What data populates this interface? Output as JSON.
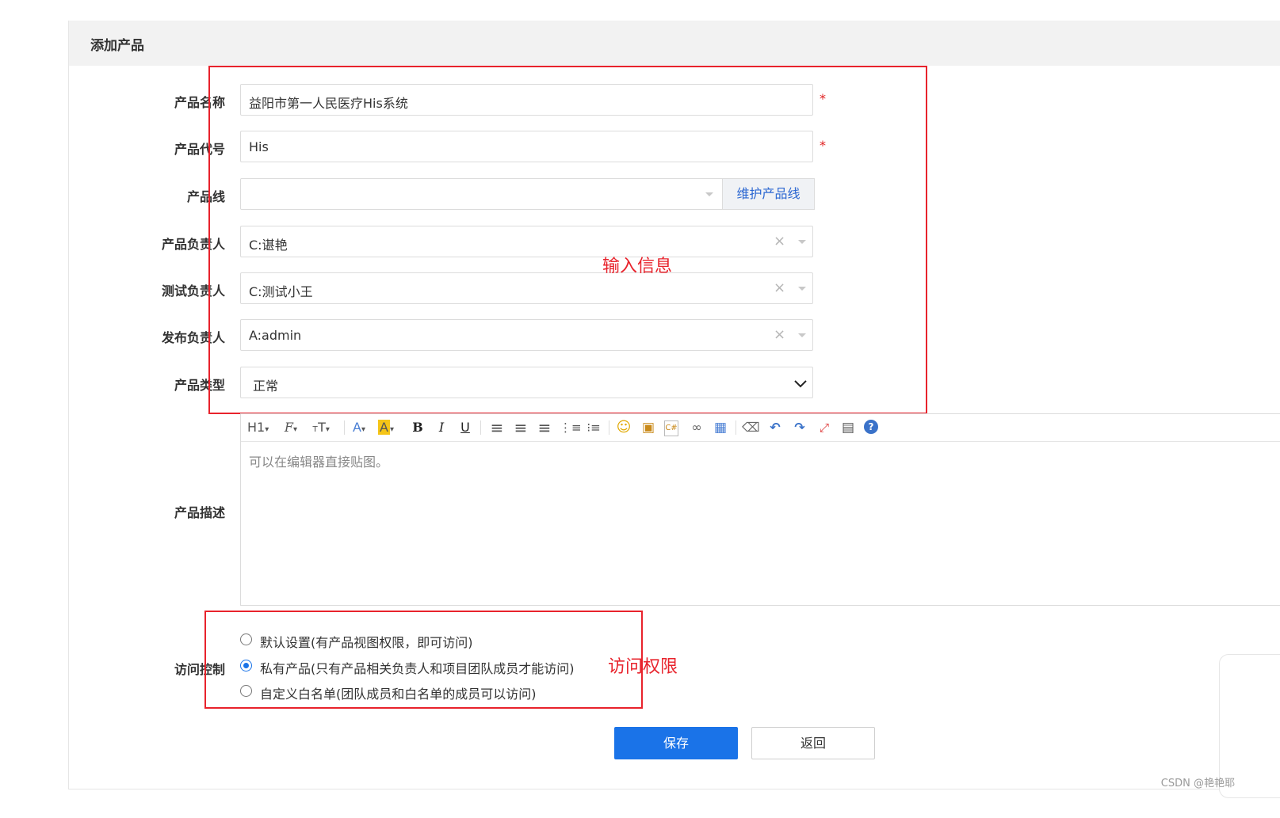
{
  "page": {
    "title": "添加产品"
  },
  "form": {
    "product_name": {
      "label": "产品名称",
      "value": "益阳市第一人民医疗His系统",
      "required": "*"
    },
    "product_code": {
      "label": "产品代号",
      "value": "His",
      "required": "*"
    },
    "product_line": {
      "label": "产品线",
      "value": "",
      "addon": "维护产品线"
    },
    "product_owner": {
      "label": "产品负责人",
      "value": "C:谌艳",
      "clear_icon": "×"
    },
    "test_owner": {
      "label": "测试负责人",
      "value": "C:测试小王",
      "clear_icon": "×"
    },
    "release_owner": {
      "label": "发布负责人",
      "value": "A:admin",
      "clear_icon": "×"
    },
    "product_type": {
      "label": "产品类型",
      "value": "正常"
    },
    "description": {
      "label": "产品描述",
      "placeholder": "可以在编辑器直接贴图。",
      "toolbar": [
        {
          "name": "heading-icon",
          "glyph": "H1▾"
        },
        {
          "name": "font-family-icon",
          "glyph": "ℱ▾"
        },
        {
          "name": "font-size-icon",
          "glyph": "тT▾"
        },
        {
          "name": "font-color-icon",
          "glyph": "A▾"
        },
        {
          "name": "highlight-icon",
          "glyph": "A▾"
        },
        {
          "name": "bold-icon",
          "glyph": "B"
        },
        {
          "name": "italic-icon",
          "glyph": "I"
        },
        {
          "name": "underline-icon",
          "glyph": "U"
        },
        {
          "name": "align-left-icon",
          "glyph": "≡"
        },
        {
          "name": "align-center-icon",
          "glyph": "≡"
        },
        {
          "name": "align-right-icon",
          "glyph": "≡"
        },
        {
          "name": "ordered-list-icon",
          "glyph": "⋮≡"
        },
        {
          "name": "unordered-list-icon",
          "glyph": "⁝≡"
        },
        {
          "name": "emoji-icon",
          "glyph": "☺"
        },
        {
          "name": "image-icon",
          "glyph": "▣"
        },
        {
          "name": "code-icon",
          "glyph": "C#"
        },
        {
          "name": "link-icon",
          "glyph": "∞"
        },
        {
          "name": "table-icon",
          "glyph": "▦"
        },
        {
          "name": "eraser-icon",
          "glyph": "⌫"
        },
        {
          "name": "undo-icon",
          "glyph": "↶"
        },
        {
          "name": "redo-icon",
          "glyph": "↷"
        },
        {
          "name": "fullscreen-icon",
          "glyph": "⤢"
        },
        {
          "name": "paste-icon",
          "glyph": "▤"
        },
        {
          "name": "help-icon",
          "glyph": "?"
        }
      ]
    },
    "access": {
      "label": "访问控制",
      "options": [
        {
          "text": "默认设置(有产品视图权限，即可访问)",
          "checked": false
        },
        {
          "text": "私有产品(只有产品相关负责人和项目团队成员才能访问)",
          "checked": true
        },
        {
          "text": "自定义白名单(团队成员和白名单的成员可以访问)",
          "checked": false
        }
      ]
    }
  },
  "buttons": {
    "save": "保存",
    "back": "返回"
  },
  "annotations": {
    "input_info": "输入信息",
    "access_rights": "访问权限",
    "color": "#e8232c"
  },
  "watermark": "CSDN @艳艳耶",
  "colors": {
    "primary": "#1a73e8",
    "header_bg": "#f2f2f2",
    "link": "#2a66d1"
  }
}
